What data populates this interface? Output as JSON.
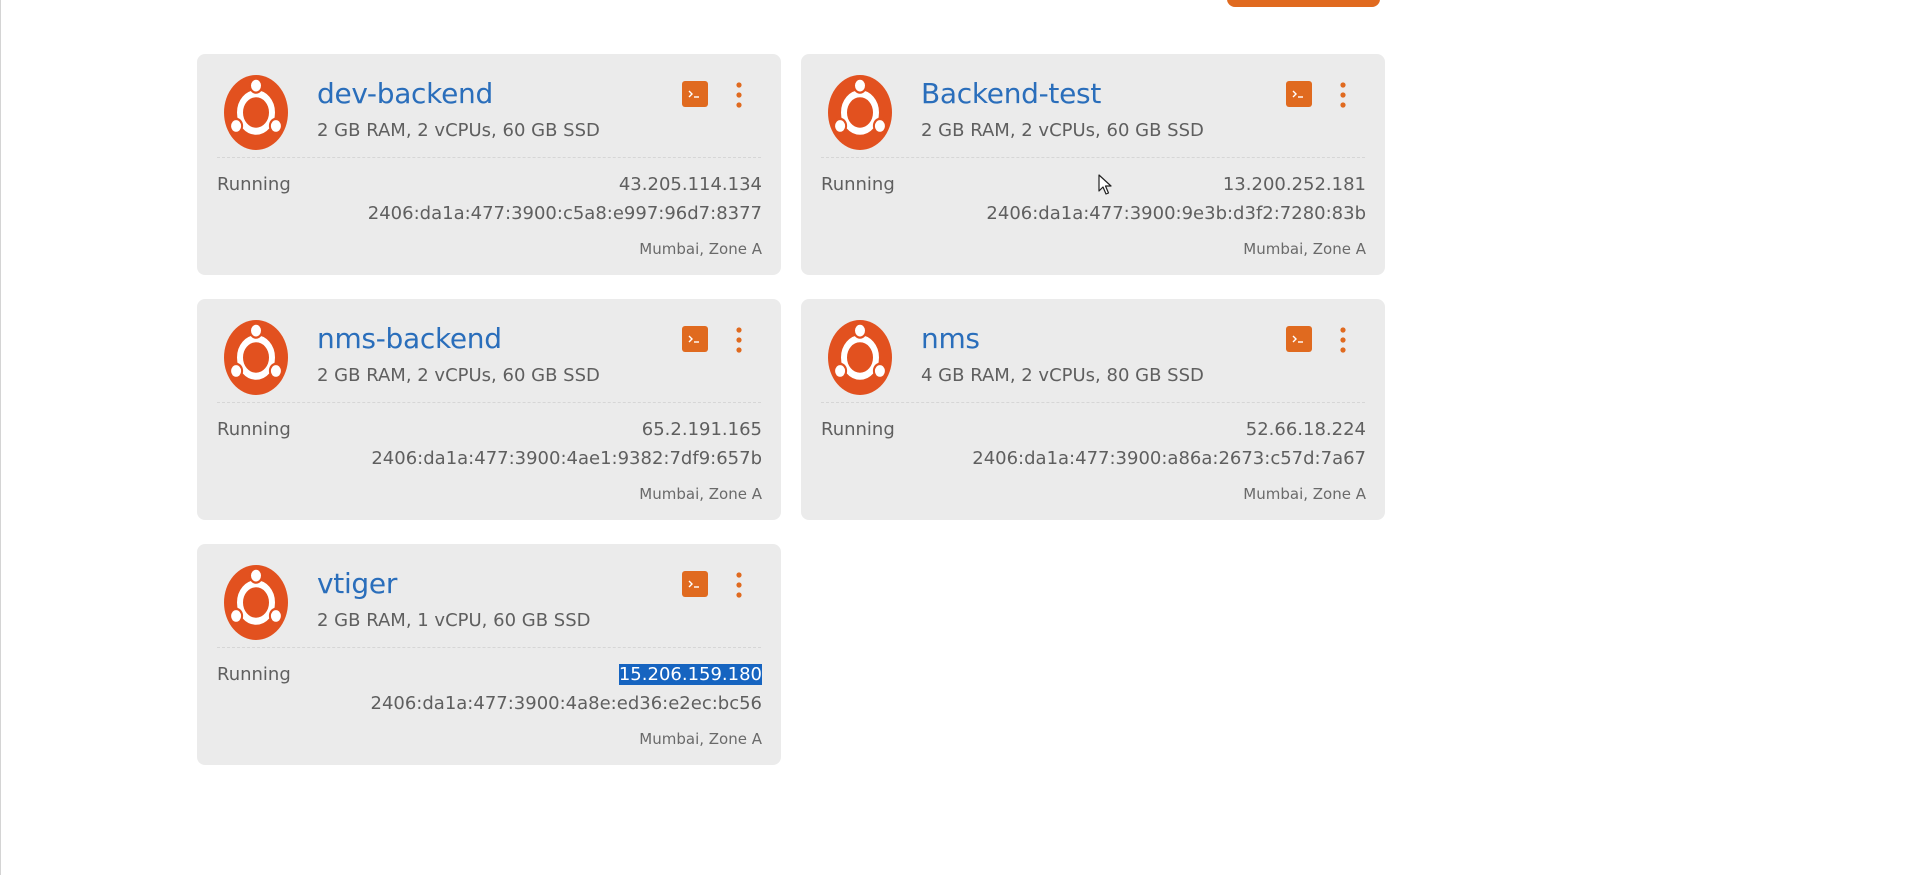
{
  "colors": {
    "accent": "#e06a1f",
    "title": "#2a6ebb",
    "card_bg": "#ebebeb",
    "selection": "#1664c0"
  },
  "instances": [
    {
      "name": "dev-backend",
      "specs": "2 GB RAM, 2 vCPUs, 60 GB SSD",
      "status": "Running",
      "ipv4": "43.205.114.134",
      "ipv6": "2406:da1a:477:3900:c5a8:e997:96d7:8377",
      "location": "Mumbai, Zone A",
      "icon": "ubuntu-logo-icon"
    },
    {
      "name": "Backend-test",
      "specs": "2 GB RAM, 2 vCPUs, 60 GB SSD",
      "status": "Running",
      "ipv4": "13.200.252.181",
      "ipv6": "2406:da1a:477:3900:9e3b:d3f2:7280:83b",
      "location": "Mumbai, Zone A",
      "icon": "ubuntu-logo-icon"
    },
    {
      "name": "nms-backend",
      "specs": "2 GB RAM, 2 vCPUs, 60 GB SSD",
      "status": "Running",
      "ipv4": "65.2.191.165",
      "ipv6": "2406:da1a:477:3900:4ae1:9382:7df9:657b",
      "location": "Mumbai, Zone A",
      "icon": "ubuntu-logo-icon"
    },
    {
      "name": "nms",
      "specs": "4 GB RAM, 2 vCPUs, 80 GB SSD",
      "status": "Running",
      "ipv4": "52.66.18.224",
      "ipv6": "2406:da1a:477:3900:a86a:2673:c57d:7a67",
      "location": "Mumbai, Zone A",
      "icon": "ubuntu-logo-icon"
    },
    {
      "name": "vtiger",
      "specs": "2 GB RAM, 1 vCPU, 60 GB SSD",
      "status": "Running",
      "ipv4": "15.206.159.180",
      "ipv6": "2406:da1a:477:3900:4a8e:ed36:e2ec:bc56",
      "location": "Mumbai, Zone A",
      "icon": "ubuntu-logo-icon",
      "ipv4_selected": true
    }
  ]
}
